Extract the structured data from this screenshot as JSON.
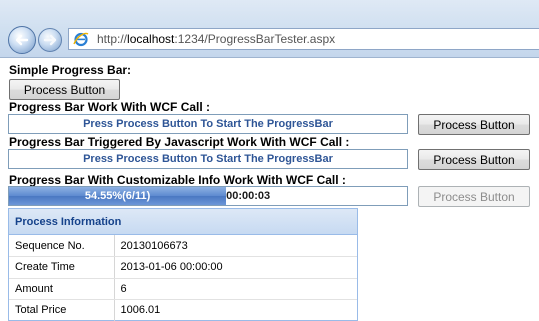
{
  "browser": {
    "url_prefix": "http://",
    "url_host": "localhost",
    "url_rest": ":1234/ProgressBarTester.aspx"
  },
  "page": {
    "simple": {
      "label": "Simple Progress Bar:",
      "button": "Process Button"
    },
    "wcf": {
      "label": "Progress Bar Work With WCF Call :",
      "bar_text": "Press Process Button To Start The ProgressBar",
      "button": "Process Button"
    },
    "js": {
      "label": "Progress Bar Triggered By Javascript Work With WCF Call :",
      "bar_text": "Press Process Button To Start The ProgressBar",
      "button": "Process Button"
    },
    "custom": {
      "label": "Progress Bar With Customizable Info Work With WCF Call :",
      "progress_text": "54.55%(6/11)",
      "progress_fraction": 0.5455,
      "elapsed": "00:00:03",
      "button": "Process Button",
      "button_disabled": true
    },
    "info": {
      "title": "Process Information",
      "rows": [
        {
          "key": "Sequence No.",
          "value": "20130106673"
        },
        {
          "key": "Create Time",
          "value": "2013-01-06 00:00:00"
        },
        {
          "key": "Amount",
          "value": "6"
        },
        {
          "key": "Total Price",
          "value": "1006.01"
        }
      ]
    }
  },
  "colors": {
    "progress_fill": "#5d8ad0",
    "bar_text": "#2e5596",
    "panel_header_text": "#15428b"
  }
}
